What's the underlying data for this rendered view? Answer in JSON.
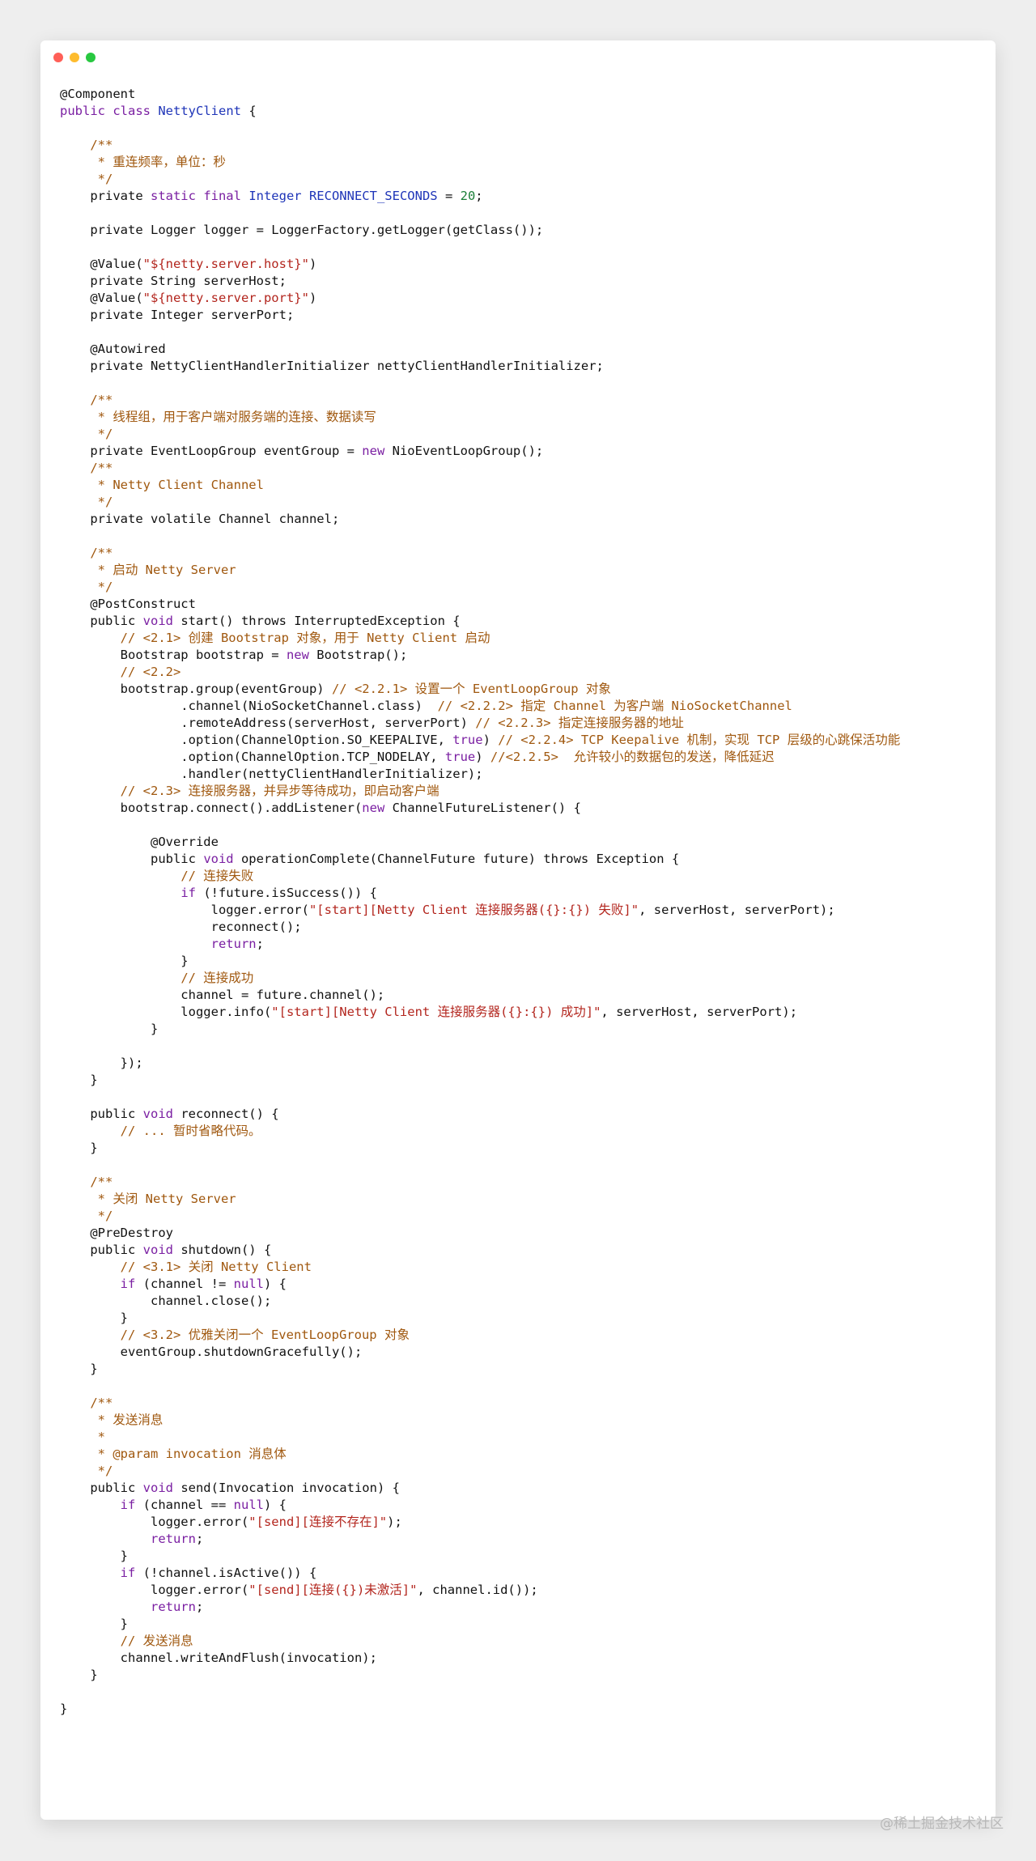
{
  "theme": {
    "background": "#eeeeee",
    "window_bg": "#ffffff",
    "text": "#111111",
    "comment": "#a0580f",
    "keyword": "#7a1fa2",
    "type": "#1f35b8",
    "string": "#b3261e",
    "number": "#1a7f37"
  },
  "window": {
    "controls": [
      "close",
      "minimize",
      "zoom"
    ]
  },
  "code_lines": [
    [
      [
        "t",
        "@Component"
      ]
    ],
    [
      [
        "k",
        "public "
      ],
      [
        "k",
        "class "
      ],
      [
        "y",
        "NettyClient"
      ],
      [
        "t",
        " {"
      ]
    ],
    [
      [
        "t",
        ""
      ]
    ],
    [
      [
        "t",
        "    "
      ],
      [
        "c",
        "/**"
      ]
    ],
    [
      [
        "c",
        "     * 重连频率，单位：秒"
      ]
    ],
    [
      [
        "c",
        "     */"
      ]
    ],
    [
      [
        "t",
        "    private "
      ],
      [
        "k",
        "static "
      ],
      [
        "k",
        "final "
      ],
      [
        "y",
        "Integer RECONNECT_SECONDS"
      ],
      [
        "t",
        " = "
      ],
      [
        "n",
        "20"
      ],
      [
        "t",
        ";"
      ]
    ],
    [
      [
        "t",
        ""
      ]
    ],
    [
      [
        "t",
        "    private Logger logger = LoggerFactory.getLogger(getClass());"
      ]
    ],
    [
      [
        "t",
        ""
      ]
    ],
    [
      [
        "t",
        "    @Value("
      ],
      [
        "s",
        "\"${netty.server.host}\""
      ],
      [
        "t",
        ")"
      ]
    ],
    [
      [
        "t",
        "    private String serverHost;"
      ]
    ],
    [
      [
        "t",
        "    @Value("
      ],
      [
        "s",
        "\"${netty.server.port}\""
      ],
      [
        "t",
        ")"
      ]
    ],
    [
      [
        "t",
        "    private Integer serverPort;"
      ]
    ],
    [
      [
        "t",
        ""
      ]
    ],
    [
      [
        "t",
        "    @Autowired"
      ]
    ],
    [
      [
        "t",
        "    private NettyClientHandlerInitializer nettyClientHandlerInitializer;"
      ]
    ],
    [
      [
        "t",
        ""
      ]
    ],
    [
      [
        "t",
        "    "
      ],
      [
        "c",
        "/**"
      ]
    ],
    [
      [
        "c",
        "     * 线程组，用于客户端对服务端的连接、数据读写"
      ]
    ],
    [
      [
        "c",
        "     */"
      ]
    ],
    [
      [
        "t",
        "    private EventLoopGroup eventGroup = "
      ],
      [
        "k",
        "new"
      ],
      [
        "t",
        " NioEventLoopGroup();"
      ]
    ],
    [
      [
        "t",
        "    "
      ],
      [
        "c",
        "/**"
      ]
    ],
    [
      [
        "c",
        "     * Netty Client Channel"
      ]
    ],
    [
      [
        "c",
        "     */"
      ]
    ],
    [
      [
        "t",
        "    private volatile Channel channel;"
      ]
    ],
    [
      [
        "t",
        ""
      ]
    ],
    [
      [
        "t",
        "    "
      ],
      [
        "c",
        "/**"
      ]
    ],
    [
      [
        "c",
        "     * 启动 Netty Server"
      ]
    ],
    [
      [
        "c",
        "     */"
      ]
    ],
    [
      [
        "t",
        "    @PostConstruct"
      ]
    ],
    [
      [
        "t",
        "    public "
      ],
      [
        "k",
        "void"
      ],
      [
        "t",
        " start() throws InterruptedException {"
      ]
    ],
    [
      [
        "t",
        "        "
      ],
      [
        "c",
        "// <2.1> 创建 Bootstrap 对象，用于 Netty Client 启动"
      ]
    ],
    [
      [
        "t",
        "        Bootstrap bootstrap = "
      ],
      [
        "k",
        "new"
      ],
      [
        "t",
        " Bootstrap();"
      ]
    ],
    [
      [
        "t",
        "        "
      ],
      [
        "c",
        "// <2.2>"
      ]
    ],
    [
      [
        "t",
        "        bootstrap.group(eventGroup) "
      ],
      [
        "c",
        "// <2.2.1> 设置一个 EventLoopGroup 对象"
      ]
    ],
    [
      [
        "t",
        "                .channel(NioSocketChannel.class)  "
      ],
      [
        "c",
        "// <2.2.2> 指定 Channel 为客户端 NioSocketChannel"
      ]
    ],
    [
      [
        "t",
        "                .remoteAddress(serverHost, serverPort) "
      ],
      [
        "c",
        "// <2.2.3> 指定连接服务器的地址"
      ]
    ],
    [
      [
        "t",
        "                .option(ChannelOption.SO_KEEPALIVE, "
      ],
      [
        "k",
        "true"
      ],
      [
        "t",
        ") "
      ],
      [
        "c",
        "// <2.2.4> TCP Keepalive 机制，实现 TCP 层级的心跳保活功能"
      ]
    ],
    [
      [
        "t",
        "                .option(ChannelOption.TCP_NODELAY, "
      ],
      [
        "k",
        "true"
      ],
      [
        "t",
        ") "
      ],
      [
        "c",
        "//<2.2.5>  允许较小的数据包的发送，降低延迟"
      ]
    ],
    [
      [
        "t",
        "                .handler(nettyClientHandlerInitializer);"
      ]
    ],
    [
      [
        "t",
        "        "
      ],
      [
        "c",
        "// <2.3> 连接服务器，并异步等待成功，即启动客户端"
      ]
    ],
    [
      [
        "t",
        "        bootstrap.connect().addListener("
      ],
      [
        "k",
        "new"
      ],
      [
        "t",
        " ChannelFutureListener() {"
      ]
    ],
    [
      [
        "t",
        ""
      ]
    ],
    [
      [
        "t",
        "            @Override"
      ]
    ],
    [
      [
        "t",
        "            public "
      ],
      [
        "k",
        "void"
      ],
      [
        "t",
        " operationComplete(ChannelFuture future) throws Exception {"
      ]
    ],
    [
      [
        "t",
        "                "
      ],
      [
        "c",
        "// 连接失败"
      ]
    ],
    [
      [
        "t",
        "                "
      ],
      [
        "k",
        "if"
      ],
      [
        "t",
        " (!future.isSuccess()) {"
      ]
    ],
    [
      [
        "t",
        "                    logger.error("
      ],
      [
        "s",
        "\"[start][Netty Client 连接服务器({}:{}) 失败]\""
      ],
      [
        "t",
        ", serverHost, serverPort);"
      ]
    ],
    [
      [
        "t",
        "                    reconnect();"
      ]
    ],
    [
      [
        "t",
        "                    "
      ],
      [
        "k",
        "return"
      ],
      [
        "t",
        ";"
      ]
    ],
    [
      [
        "t",
        "                }"
      ]
    ],
    [
      [
        "t",
        "                "
      ],
      [
        "c",
        "// 连接成功"
      ]
    ],
    [
      [
        "t",
        "                channel = future.channel();"
      ]
    ],
    [
      [
        "t",
        "                logger.info("
      ],
      [
        "s",
        "\"[start][Netty Client 连接服务器({}:{}) 成功]\""
      ],
      [
        "t",
        ", serverHost, serverPort);"
      ]
    ],
    [
      [
        "t",
        "            }"
      ]
    ],
    [
      [
        "t",
        ""
      ]
    ],
    [
      [
        "t",
        "        });"
      ]
    ],
    [
      [
        "t",
        "    }"
      ]
    ],
    [
      [
        "t",
        ""
      ]
    ],
    [
      [
        "t",
        "    public "
      ],
      [
        "k",
        "void"
      ],
      [
        "t",
        " reconnect() {"
      ]
    ],
    [
      [
        "t",
        "        "
      ],
      [
        "c",
        "// ... 暂时省略代码。"
      ]
    ],
    [
      [
        "t",
        "    }"
      ]
    ],
    [
      [
        "t",
        ""
      ]
    ],
    [
      [
        "t",
        "    "
      ],
      [
        "c",
        "/**"
      ]
    ],
    [
      [
        "c",
        "     * 关闭 Netty Server"
      ]
    ],
    [
      [
        "c",
        "     */"
      ]
    ],
    [
      [
        "t",
        "    @PreDestroy"
      ]
    ],
    [
      [
        "t",
        "    public "
      ],
      [
        "k",
        "void"
      ],
      [
        "t",
        " shutdown() {"
      ]
    ],
    [
      [
        "t",
        "        "
      ],
      [
        "c",
        "// <3.1> 关闭 Netty Client"
      ]
    ],
    [
      [
        "t",
        "        "
      ],
      [
        "k",
        "if"
      ],
      [
        "t",
        " (channel != "
      ],
      [
        "k",
        "null"
      ],
      [
        "t",
        ") {"
      ]
    ],
    [
      [
        "t",
        "            channel.close();"
      ]
    ],
    [
      [
        "t",
        "        }"
      ]
    ],
    [
      [
        "t",
        "        "
      ],
      [
        "c",
        "// <3.2> 优雅关闭一个 EventLoopGroup 对象"
      ]
    ],
    [
      [
        "t",
        "        eventGroup.shutdownGracefully();"
      ]
    ],
    [
      [
        "t",
        "    }"
      ]
    ],
    [
      [
        "t",
        ""
      ]
    ],
    [
      [
        "t",
        "    "
      ],
      [
        "c",
        "/**"
      ]
    ],
    [
      [
        "c",
        "     * 发送消息"
      ]
    ],
    [
      [
        "c",
        "     *"
      ]
    ],
    [
      [
        "c",
        "     * @param invocation 消息体"
      ]
    ],
    [
      [
        "c",
        "     */"
      ]
    ],
    [
      [
        "t",
        "    public "
      ],
      [
        "k",
        "void"
      ],
      [
        "t",
        " send(Invocation invocation) {"
      ]
    ],
    [
      [
        "t",
        "        "
      ],
      [
        "k",
        "if"
      ],
      [
        "t",
        " (channel == "
      ],
      [
        "k",
        "null"
      ],
      [
        "t",
        ") {"
      ]
    ],
    [
      [
        "t",
        "            logger.error("
      ],
      [
        "s",
        "\"[send][连接不存在]\""
      ],
      [
        "t",
        ");"
      ]
    ],
    [
      [
        "t",
        "            "
      ],
      [
        "k",
        "return"
      ],
      [
        "t",
        ";"
      ]
    ],
    [
      [
        "t",
        "        }"
      ]
    ],
    [
      [
        "t",
        "        "
      ],
      [
        "k",
        "if"
      ],
      [
        "t",
        " (!channel.isActive()) {"
      ]
    ],
    [
      [
        "t",
        "            logger.error("
      ],
      [
        "s",
        "\"[send][连接({})未激活]\""
      ],
      [
        "t",
        ", channel.id());"
      ]
    ],
    [
      [
        "t",
        "            "
      ],
      [
        "k",
        "return"
      ],
      [
        "t",
        ";"
      ]
    ],
    [
      [
        "t",
        "        }"
      ]
    ],
    [
      [
        "t",
        "        "
      ],
      [
        "c",
        "// 发送消息"
      ]
    ],
    [
      [
        "t",
        "        channel.writeAndFlush(invocation);"
      ]
    ],
    [
      [
        "t",
        "    }"
      ]
    ],
    [
      [
        "t",
        ""
      ]
    ],
    [
      [
        "t",
        "}"
      ]
    ]
  ],
  "watermark": "@稀土掘金技术社区"
}
